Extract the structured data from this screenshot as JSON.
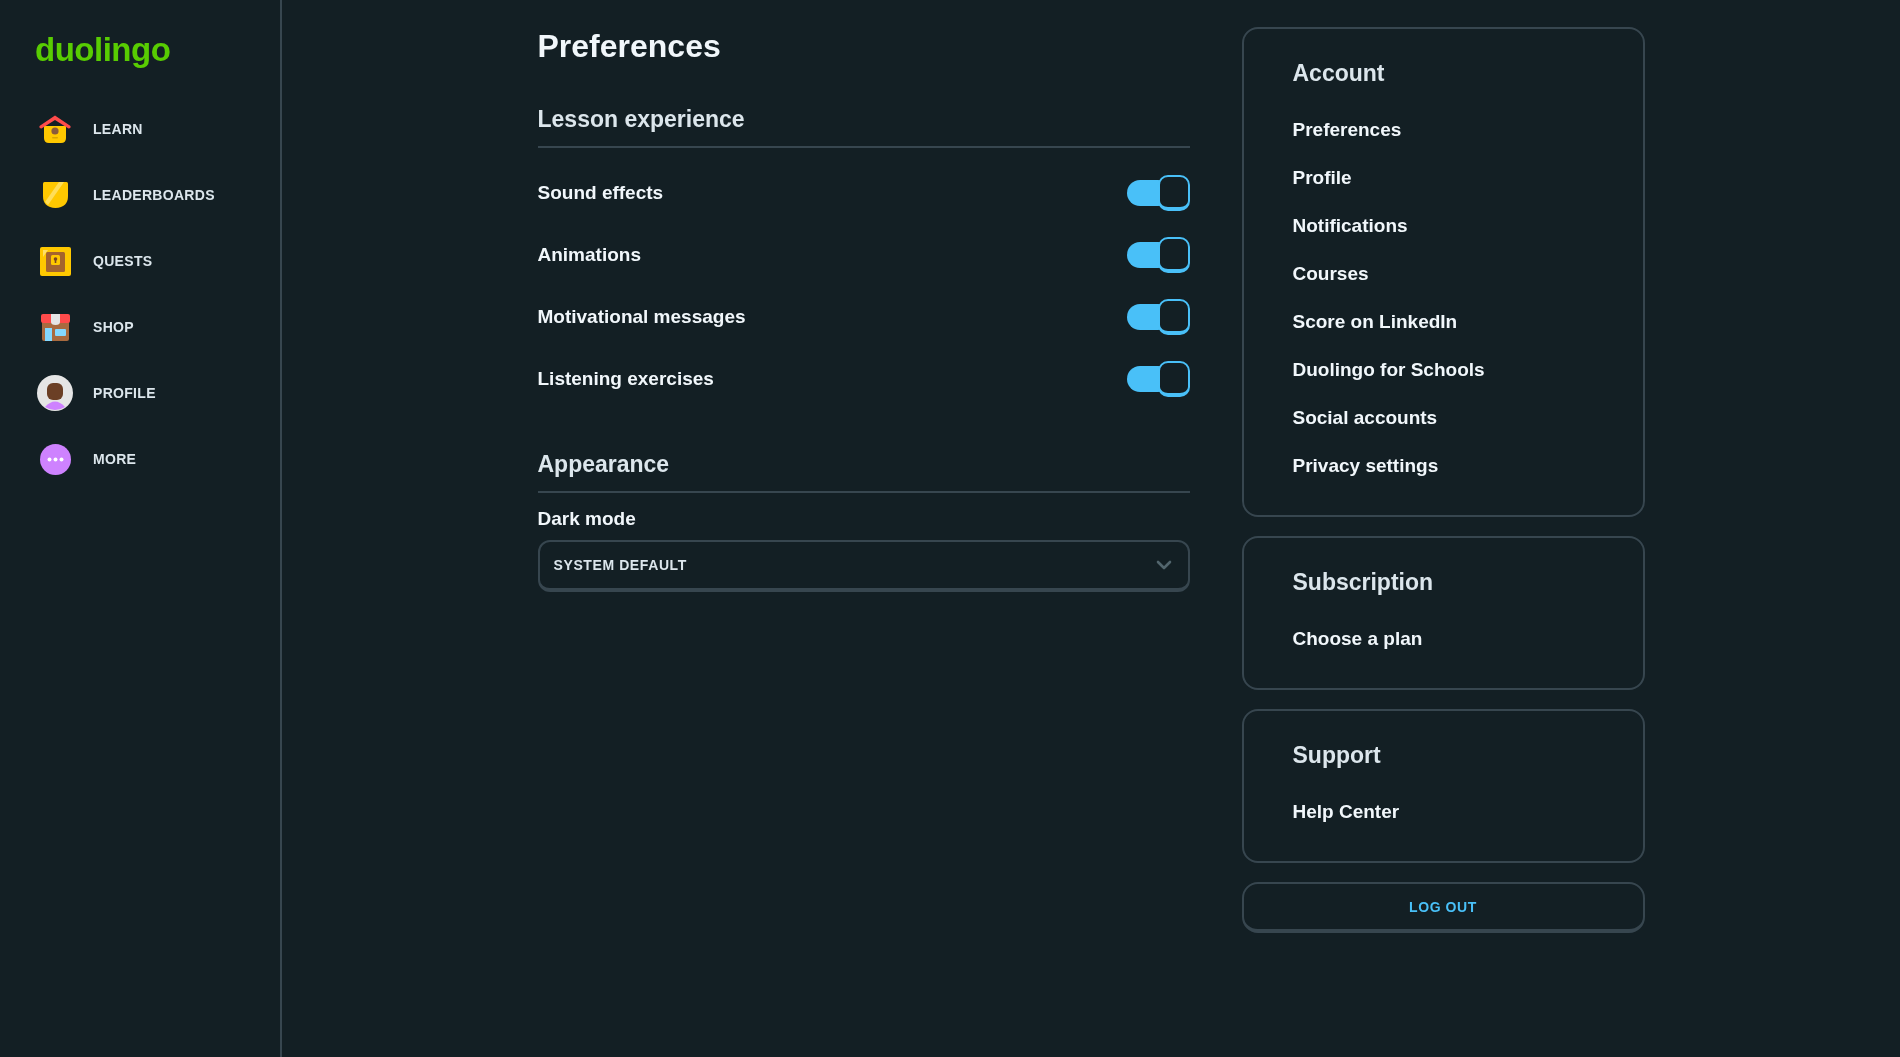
{
  "sidebar": {
    "logo": "duolingo",
    "items": [
      {
        "kind": "learn",
        "label": "LEARN",
        "selected": false
      },
      {
        "kind": "leaderboards",
        "label": "LEADERBOARDS",
        "selected": false
      },
      {
        "kind": "quests",
        "label": "QUESTS",
        "selected": false
      },
      {
        "kind": "shop",
        "label": "SHOP",
        "selected": false
      },
      {
        "kind": "profile",
        "label": "PROFILE",
        "selected": false
      },
      {
        "kind": "more",
        "label": "MORE",
        "selected": false
      }
    ]
  },
  "main": {
    "title": "Preferences",
    "sections": [
      {
        "heading": "Lesson experience",
        "settings": [
          {
            "kind": "toggle",
            "label": "Sound effects",
            "on": true
          },
          {
            "kind": "toggle",
            "label": "Animations",
            "on": true
          },
          {
            "kind": "toggle",
            "label": "Motivational messages",
            "on": true
          },
          {
            "kind": "toggle",
            "label": "Listening exercises",
            "on": true
          }
        ]
      },
      {
        "heading": "Appearance",
        "settings": [
          {
            "kind": "dropdown",
            "label": "Dark mode",
            "value": "SYSTEM DEFAULT"
          }
        ]
      }
    ]
  },
  "side_panel": {
    "cards": [
      {
        "heading": "Account",
        "links": [
          "Preferences",
          "Profile",
          "Notifications",
          "Courses",
          "Score on LinkedIn",
          "Duolingo for Schools",
          "Social accounts",
          "Privacy settings"
        ]
      },
      {
        "heading": "Subscription",
        "links": [
          "Choose a plan"
        ]
      },
      {
        "heading": "Support",
        "links": [
          "Help Center"
        ]
      }
    ],
    "logout_button": "LOG OUT"
  }
}
